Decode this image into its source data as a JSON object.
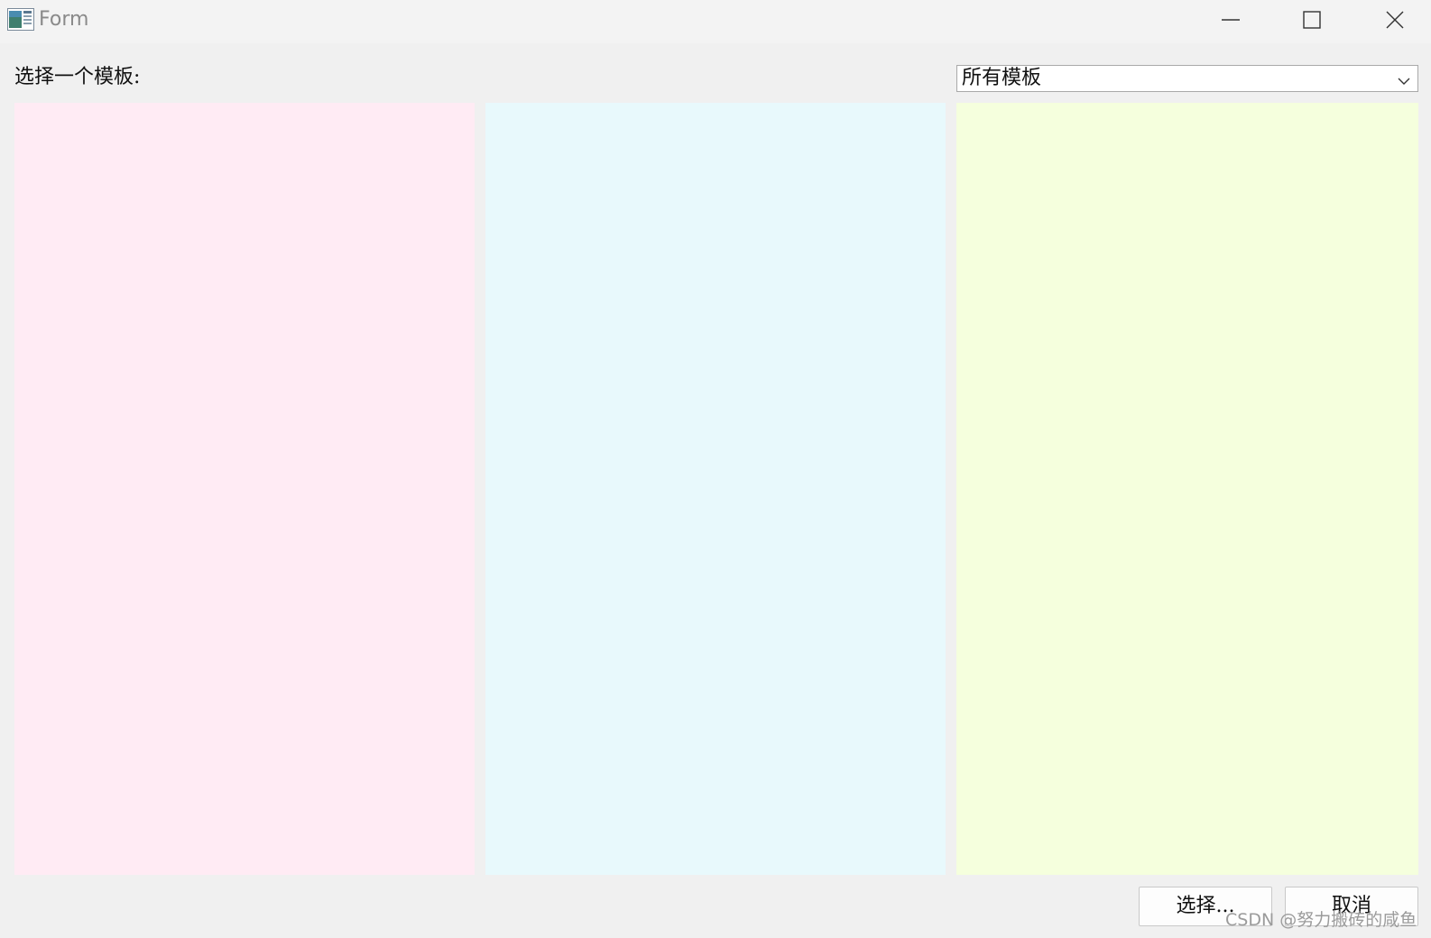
{
  "window": {
    "title": "Form",
    "icons": {
      "app": "app-icon",
      "minimize": "minimize-icon",
      "maximize": "maximize-icon",
      "close": "close-icon"
    }
  },
  "template_picker": {
    "label": "选择一个模板:",
    "filter_selected": "所有模板",
    "dropdown_icon": "chevron-down-icon"
  },
  "panels": [
    {
      "color": "#ffebf4"
    },
    {
      "color": "#e8f9fc"
    },
    {
      "color": "#f5ffdd"
    }
  ],
  "buttons": {
    "select_label": "选择...",
    "cancel_label": "取消"
  },
  "watermark": "CSDN @努力搬砖的咸鱼"
}
